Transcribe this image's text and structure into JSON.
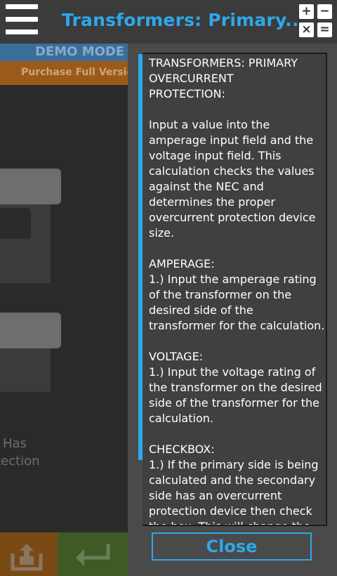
{
  "header": {
    "title": "Transformers: Primary...",
    "calc_keys": [
      "+",
      "−",
      "×",
      "="
    ]
  },
  "background": {
    "demo_mode": "DEMO MODE",
    "purchase": "Purchase Full Version",
    "label_line1": "Has",
    "label_line2": "tection"
  },
  "help": {
    "text": "TRANSFORMERS: PRIMARY\nOVERCURRENT\nPROTECTION:\n\nInput a value into the\namperage input field and the\nvoltage input field. This\ncalculation checks the values\nagainst the NEC and\ndetermines the proper\novercurrent protection device\nsize.\n\nAMPERAGE:\n1.) Input the amperage rating\nof the transformer on the\ndesired side of the\ntransformer for the calculation.\n\nVOLTAGE:\n1.) Input the voltage rating of\nthe transformer on the desired\nside of the transformer for the\ncalculation.\n\nCHECKBOX:\n1.) If the primary side is being\ncalculated and the secondary\nside has an overcurrent\nprotection device then check\nthe box. This will change the",
    "close_label": "Close"
  },
  "colors": {
    "accent": "#2ea8ea",
    "header_bg": "#3b3b3b",
    "demo_bg": "#3b6e99",
    "purchase_bg": "#9c5a1a"
  },
  "icons": [
    "menu-icon",
    "calculator-icon",
    "share-icon",
    "return-icon"
  ]
}
